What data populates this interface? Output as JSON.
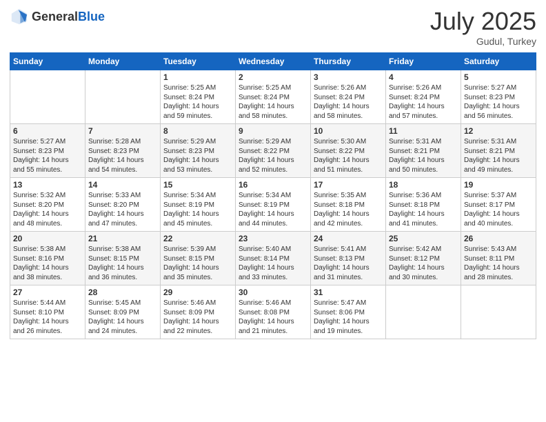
{
  "header": {
    "logo_general": "General",
    "logo_blue": "Blue",
    "month_title": "July 2025",
    "location": "Gudul, Turkey"
  },
  "weekdays": [
    "Sunday",
    "Monday",
    "Tuesday",
    "Wednesday",
    "Thursday",
    "Friday",
    "Saturday"
  ],
  "weeks": [
    [
      {
        "day": "",
        "sunrise": "",
        "sunset": "",
        "daylight": ""
      },
      {
        "day": "",
        "sunrise": "",
        "sunset": "",
        "daylight": ""
      },
      {
        "day": "1",
        "sunrise": "Sunrise: 5:25 AM",
        "sunset": "Sunset: 8:24 PM",
        "daylight": "Daylight: 14 hours and 59 minutes."
      },
      {
        "day": "2",
        "sunrise": "Sunrise: 5:25 AM",
        "sunset": "Sunset: 8:24 PM",
        "daylight": "Daylight: 14 hours and 58 minutes."
      },
      {
        "day": "3",
        "sunrise": "Sunrise: 5:26 AM",
        "sunset": "Sunset: 8:24 PM",
        "daylight": "Daylight: 14 hours and 58 minutes."
      },
      {
        "day": "4",
        "sunrise": "Sunrise: 5:26 AM",
        "sunset": "Sunset: 8:24 PM",
        "daylight": "Daylight: 14 hours and 57 minutes."
      },
      {
        "day": "5",
        "sunrise": "Sunrise: 5:27 AM",
        "sunset": "Sunset: 8:23 PM",
        "daylight": "Daylight: 14 hours and 56 minutes."
      }
    ],
    [
      {
        "day": "6",
        "sunrise": "Sunrise: 5:27 AM",
        "sunset": "Sunset: 8:23 PM",
        "daylight": "Daylight: 14 hours and 55 minutes."
      },
      {
        "day": "7",
        "sunrise": "Sunrise: 5:28 AM",
        "sunset": "Sunset: 8:23 PM",
        "daylight": "Daylight: 14 hours and 54 minutes."
      },
      {
        "day": "8",
        "sunrise": "Sunrise: 5:29 AM",
        "sunset": "Sunset: 8:23 PM",
        "daylight": "Daylight: 14 hours and 53 minutes."
      },
      {
        "day": "9",
        "sunrise": "Sunrise: 5:29 AM",
        "sunset": "Sunset: 8:22 PM",
        "daylight": "Daylight: 14 hours and 52 minutes."
      },
      {
        "day": "10",
        "sunrise": "Sunrise: 5:30 AM",
        "sunset": "Sunset: 8:22 PM",
        "daylight": "Daylight: 14 hours and 51 minutes."
      },
      {
        "day": "11",
        "sunrise": "Sunrise: 5:31 AM",
        "sunset": "Sunset: 8:21 PM",
        "daylight": "Daylight: 14 hours and 50 minutes."
      },
      {
        "day": "12",
        "sunrise": "Sunrise: 5:31 AM",
        "sunset": "Sunset: 8:21 PM",
        "daylight": "Daylight: 14 hours and 49 minutes."
      }
    ],
    [
      {
        "day": "13",
        "sunrise": "Sunrise: 5:32 AM",
        "sunset": "Sunset: 8:20 PM",
        "daylight": "Daylight: 14 hours and 48 minutes."
      },
      {
        "day": "14",
        "sunrise": "Sunrise: 5:33 AM",
        "sunset": "Sunset: 8:20 PM",
        "daylight": "Daylight: 14 hours and 47 minutes."
      },
      {
        "day": "15",
        "sunrise": "Sunrise: 5:34 AM",
        "sunset": "Sunset: 8:19 PM",
        "daylight": "Daylight: 14 hours and 45 minutes."
      },
      {
        "day": "16",
        "sunrise": "Sunrise: 5:34 AM",
        "sunset": "Sunset: 8:19 PM",
        "daylight": "Daylight: 14 hours and 44 minutes."
      },
      {
        "day": "17",
        "sunrise": "Sunrise: 5:35 AM",
        "sunset": "Sunset: 8:18 PM",
        "daylight": "Daylight: 14 hours and 42 minutes."
      },
      {
        "day": "18",
        "sunrise": "Sunrise: 5:36 AM",
        "sunset": "Sunset: 8:18 PM",
        "daylight": "Daylight: 14 hours and 41 minutes."
      },
      {
        "day": "19",
        "sunrise": "Sunrise: 5:37 AM",
        "sunset": "Sunset: 8:17 PM",
        "daylight": "Daylight: 14 hours and 40 minutes."
      }
    ],
    [
      {
        "day": "20",
        "sunrise": "Sunrise: 5:38 AM",
        "sunset": "Sunset: 8:16 PM",
        "daylight": "Daylight: 14 hours and 38 minutes."
      },
      {
        "day": "21",
        "sunrise": "Sunrise: 5:38 AM",
        "sunset": "Sunset: 8:15 PM",
        "daylight": "Daylight: 14 hours and 36 minutes."
      },
      {
        "day": "22",
        "sunrise": "Sunrise: 5:39 AM",
        "sunset": "Sunset: 8:15 PM",
        "daylight": "Daylight: 14 hours and 35 minutes."
      },
      {
        "day": "23",
        "sunrise": "Sunrise: 5:40 AM",
        "sunset": "Sunset: 8:14 PM",
        "daylight": "Daylight: 14 hours and 33 minutes."
      },
      {
        "day": "24",
        "sunrise": "Sunrise: 5:41 AM",
        "sunset": "Sunset: 8:13 PM",
        "daylight": "Daylight: 14 hours and 31 minutes."
      },
      {
        "day": "25",
        "sunrise": "Sunrise: 5:42 AM",
        "sunset": "Sunset: 8:12 PM",
        "daylight": "Daylight: 14 hours and 30 minutes."
      },
      {
        "day": "26",
        "sunrise": "Sunrise: 5:43 AM",
        "sunset": "Sunset: 8:11 PM",
        "daylight": "Daylight: 14 hours and 28 minutes."
      }
    ],
    [
      {
        "day": "27",
        "sunrise": "Sunrise: 5:44 AM",
        "sunset": "Sunset: 8:10 PM",
        "daylight": "Daylight: 14 hours and 26 minutes."
      },
      {
        "day": "28",
        "sunrise": "Sunrise: 5:45 AM",
        "sunset": "Sunset: 8:09 PM",
        "daylight": "Daylight: 14 hours and 24 minutes."
      },
      {
        "day": "29",
        "sunrise": "Sunrise: 5:46 AM",
        "sunset": "Sunset: 8:09 PM",
        "daylight": "Daylight: 14 hours and 22 minutes."
      },
      {
        "day": "30",
        "sunrise": "Sunrise: 5:46 AM",
        "sunset": "Sunset: 8:08 PM",
        "daylight": "Daylight: 14 hours and 21 minutes."
      },
      {
        "day": "31",
        "sunrise": "Sunrise: 5:47 AM",
        "sunset": "Sunset: 8:06 PM",
        "daylight": "Daylight: 14 hours and 19 minutes."
      },
      {
        "day": "",
        "sunrise": "",
        "sunset": "",
        "daylight": ""
      },
      {
        "day": "",
        "sunrise": "",
        "sunset": "",
        "daylight": ""
      }
    ]
  ]
}
